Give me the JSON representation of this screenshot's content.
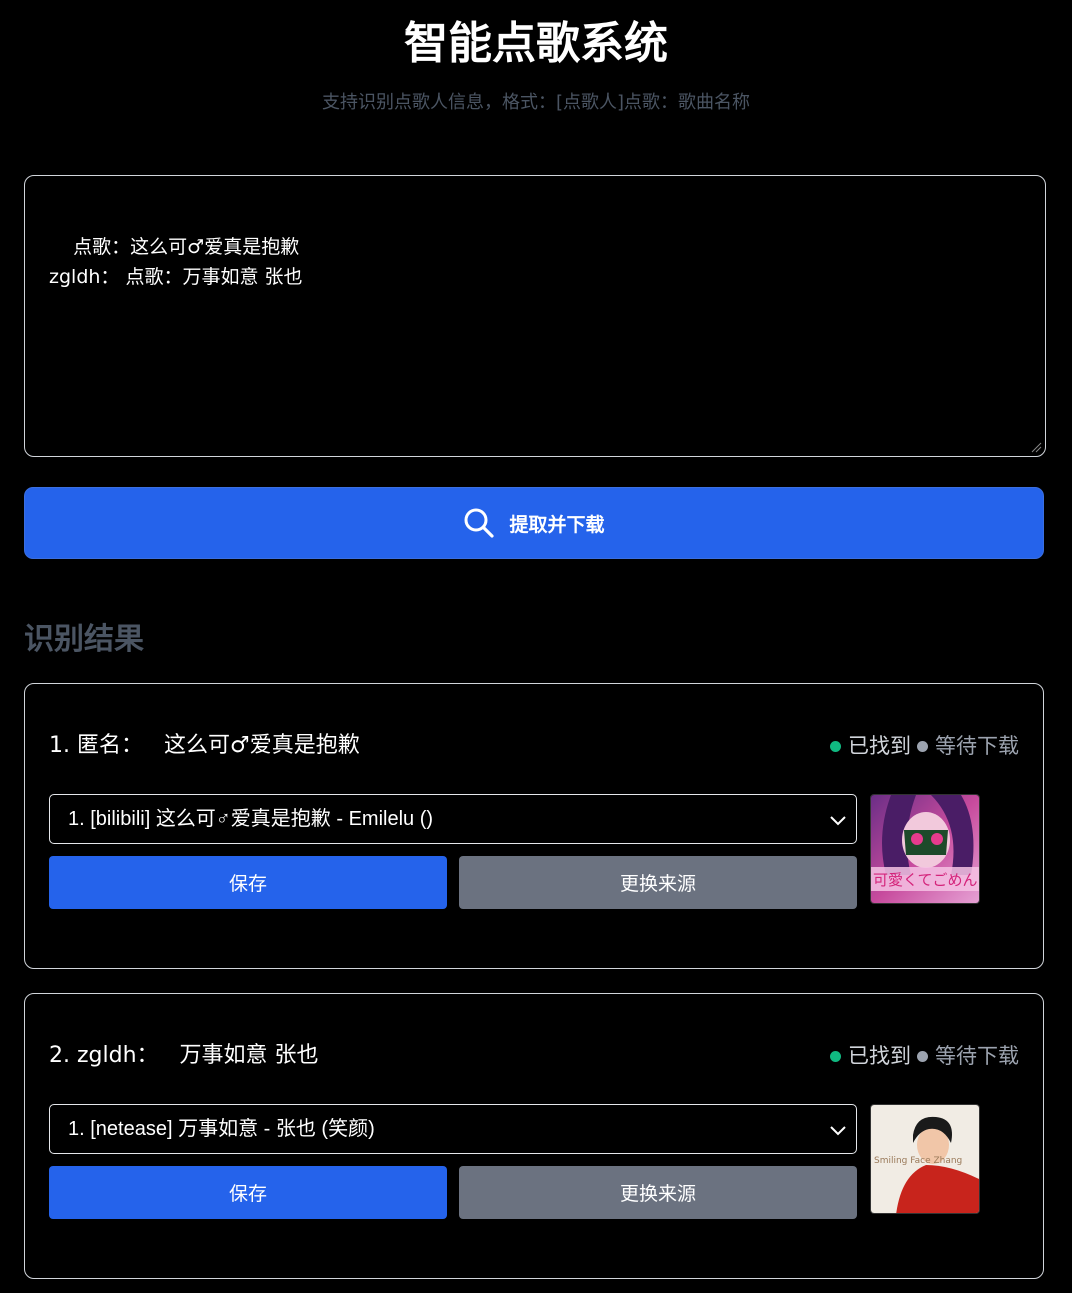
{
  "header": {
    "title": "智能点歌系统",
    "subtitle": "支持识别点歌人信息，格式：[点歌人]点歌：歌曲名称"
  },
  "request_input": {
    "value": "点歌：这么可♂爱真是抱歉\nzgldh： 点歌：万事如意 张也"
  },
  "submit_button": {
    "label": "提取并下载",
    "icon": "search-icon"
  },
  "results": {
    "title": "识别结果",
    "items": [
      {
        "index": "1.",
        "requester": "匿名：",
        "song": "这么可♂爱真是抱歉",
        "status_found": "已找到",
        "status_wait": "等待下载",
        "selected_source": "1. [bilibili] 这么可♂爱真是抱歉 - Emilelu ()",
        "save_label": "保存",
        "swap_label": "更换来源",
        "cover_text": "可愛くてごめん"
      },
      {
        "index": "2.",
        "requester": "zgldh：",
        "song": "万事如意 张也",
        "status_found": "已找到",
        "status_wait": "等待下载",
        "selected_source": "1. [netease] 万事如意 - 张也 (笑颜)",
        "save_label": "保存",
        "swap_label": "更换来源",
        "cover_text": "Smiling Face Zhang"
      }
    ]
  },
  "colors": {
    "primary": "#2563eb",
    "secondary": "#6b7280",
    "found": "#10b981",
    "waiting": "#9ca3af"
  }
}
